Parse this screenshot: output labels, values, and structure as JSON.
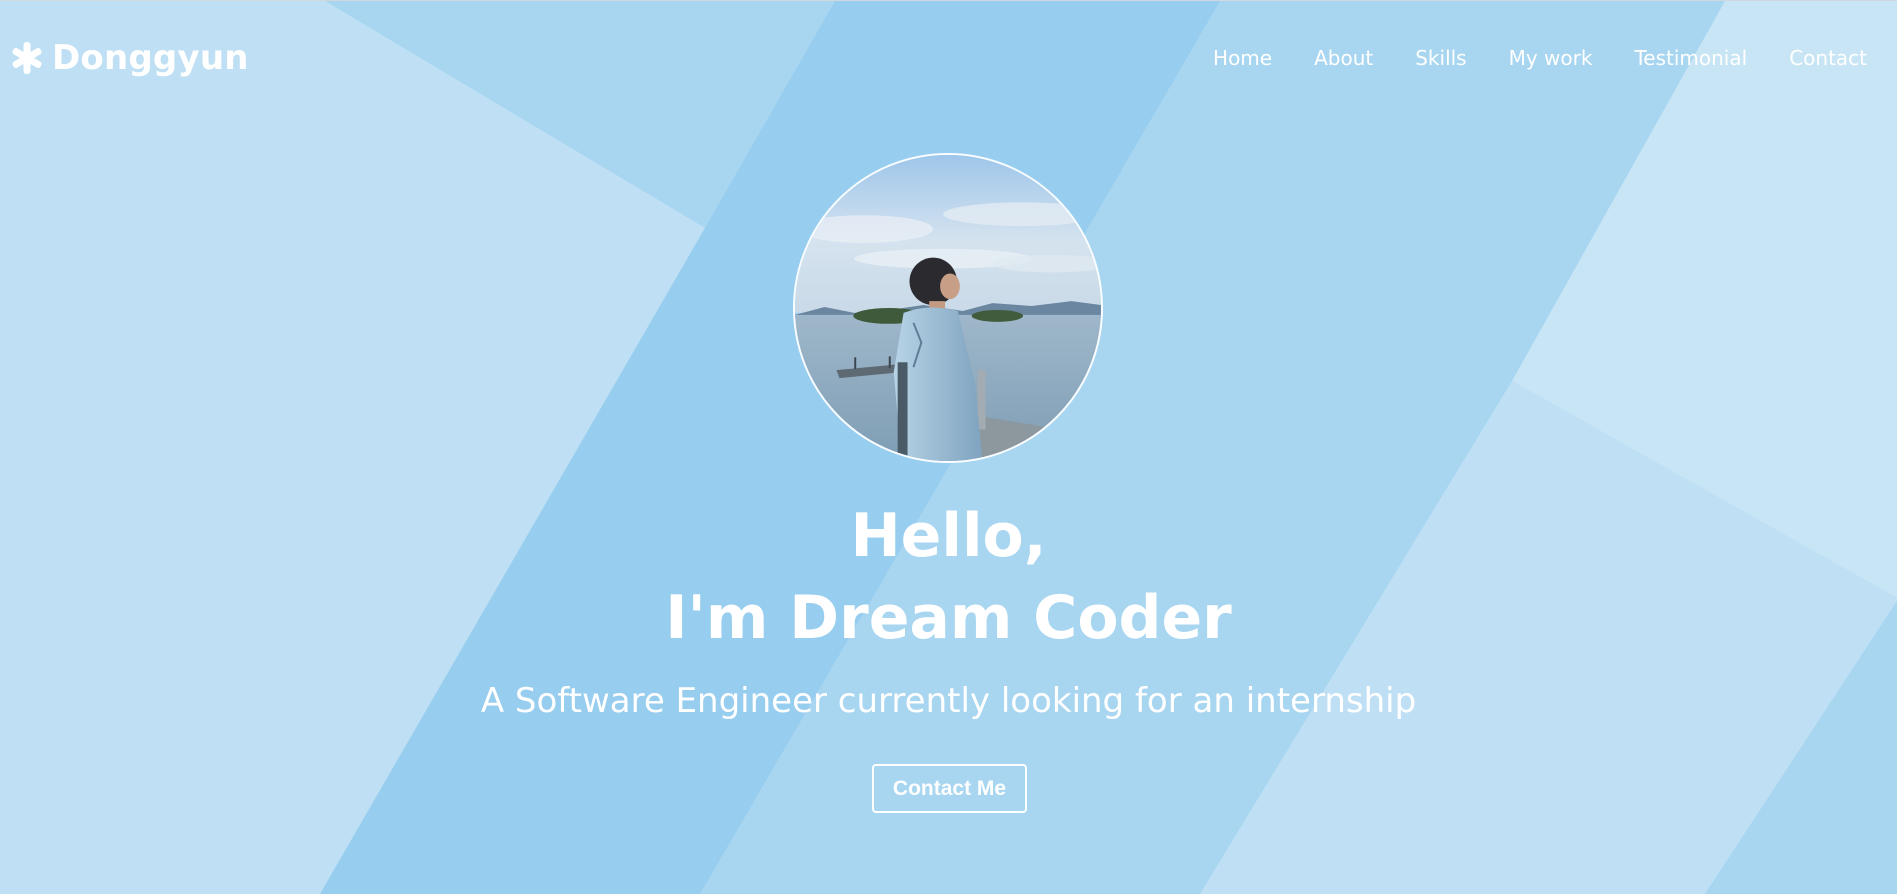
{
  "header": {
    "logo_icon": "asterisk-icon",
    "logo_text": "Donggyun"
  },
  "nav": {
    "items": [
      {
        "label": "Home"
      },
      {
        "label": "About"
      },
      {
        "label": "Skills"
      },
      {
        "label": "My work"
      },
      {
        "label": "Testimonial"
      },
      {
        "label": "Contact"
      }
    ]
  },
  "hero": {
    "avatar_alt": "profile-photo",
    "title_line1": "Hello,",
    "title_line2": "I'm Dream Coder",
    "subtitle": "A Software Engineer currently looking for an internship",
    "cta_label": "Contact Me"
  },
  "colors": {
    "hero_base": "#a8d6f1",
    "hero_light": "#bfe0f4",
    "hero_mid": "#97cdee",
    "text": "#ffffff"
  }
}
